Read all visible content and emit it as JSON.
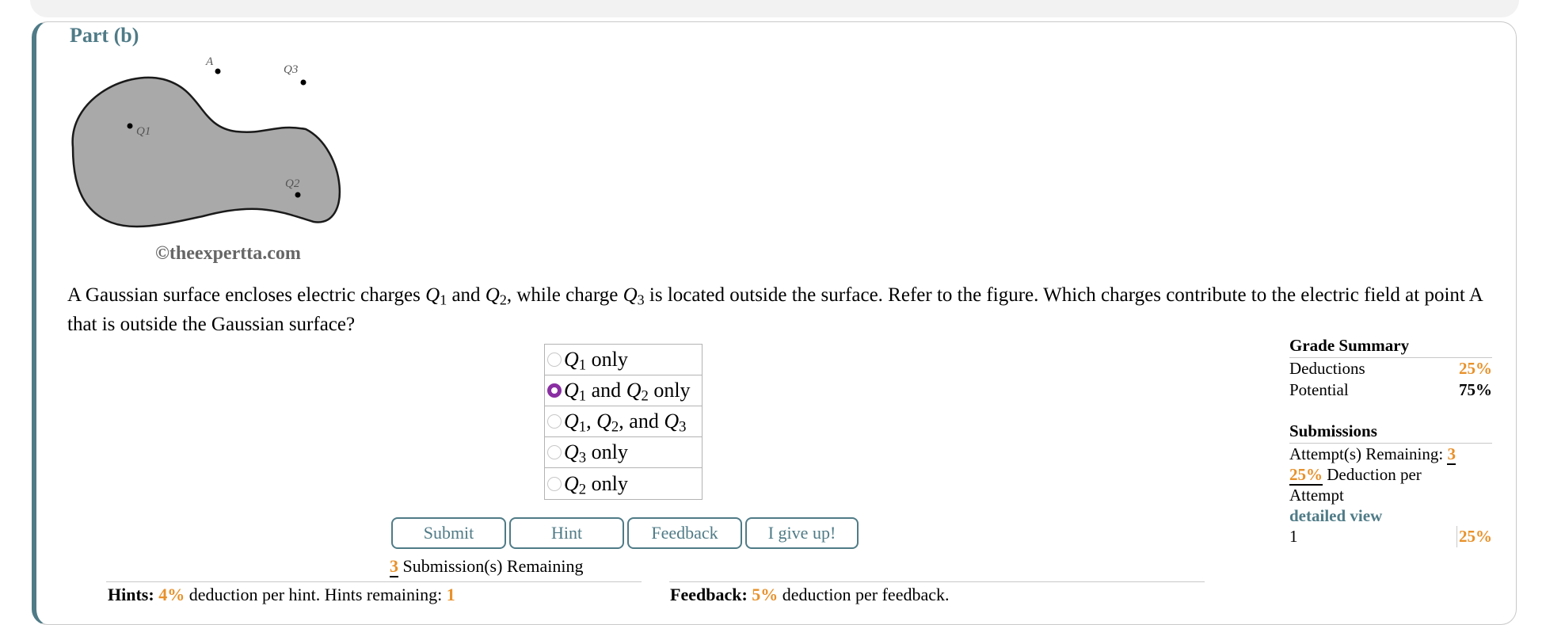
{
  "part": {
    "title": "Part (b)"
  },
  "figure": {
    "labels": {
      "a": "A",
      "q1": "Q1",
      "q2": "Q2",
      "q3": "Q3"
    },
    "copyright": "©theexpertta.com"
  },
  "question": {
    "part1": "A Gaussian surface encloses electric charges ",
    "q1": "Q",
    "q1_sub": "1",
    "part2": " and ",
    "q2": "Q",
    "q2_sub": "2",
    "part3": ", while charge ",
    "q3": "Q",
    "q3_sub": "3",
    "part4": " is located outside the surface. Refer to the figure. Which charges contribute to the electric field at point A that is outside the Gaussian surface?"
  },
  "choices": [
    {
      "checked": false,
      "parts": [
        [
          "q",
          "Q"
        ],
        [
          "sub",
          "1"
        ],
        [
          "t",
          " only"
        ]
      ]
    },
    {
      "checked": true,
      "parts": [
        [
          "q",
          "Q"
        ],
        [
          "sub",
          "1"
        ],
        [
          "t",
          " and "
        ],
        [
          "q",
          "Q"
        ],
        [
          "sub",
          "2"
        ],
        [
          "t",
          " only"
        ]
      ]
    },
    {
      "checked": false,
      "parts": [
        [
          "q",
          "Q"
        ],
        [
          "sub",
          "1"
        ],
        [
          "t",
          ", "
        ],
        [
          "q",
          "Q"
        ],
        [
          "sub",
          "2"
        ],
        [
          "t",
          ", and "
        ],
        [
          "q",
          "Q"
        ],
        [
          "sub",
          "3"
        ]
      ]
    },
    {
      "checked": false,
      "parts": [
        [
          "q",
          "Q"
        ],
        [
          "sub",
          "3"
        ],
        [
          "t",
          " only"
        ]
      ]
    },
    {
      "checked": false,
      "parts": [
        [
          "q",
          "Q"
        ],
        [
          "sub",
          "2"
        ],
        [
          "t",
          " only"
        ]
      ]
    }
  ],
  "buttons": {
    "submit": "Submit",
    "hint": "Hint",
    "feedback": "Feedback",
    "give_up": "I give up!"
  },
  "submissions_remaining": {
    "count": "3",
    "label": " Submission(s) Remaining"
  },
  "bottom": {
    "hints_label": "Hints:",
    "hints_pct": "4%",
    "hints_text": " deduction per hint. Hints remaining: ",
    "hints_remaining": "1",
    "feedback_label": "Feedback:",
    "feedback_pct": "5%",
    "feedback_text": " deduction per feedback."
  },
  "grade_summary": {
    "title": "Grade Summary",
    "deductions_label": "Deductions",
    "deductions_value": "25%",
    "potential_label": "Potential",
    "potential_value": "75%"
  },
  "submissions": {
    "title": "Submissions",
    "attempts_label": "Attempt(s) Remaining: ",
    "attempts_value": "3",
    "deduction_pct": "25%",
    "deduction_text": " Deduction per Attempt",
    "detailed_view": "detailed view",
    "history_index": "1",
    "history_value": "25%"
  },
  "colors": {
    "accent": "#4f7b87",
    "orange": "#e8912a",
    "radio_selected": "#8a2ea3",
    "surface_fill": "#a9a9a9"
  }
}
